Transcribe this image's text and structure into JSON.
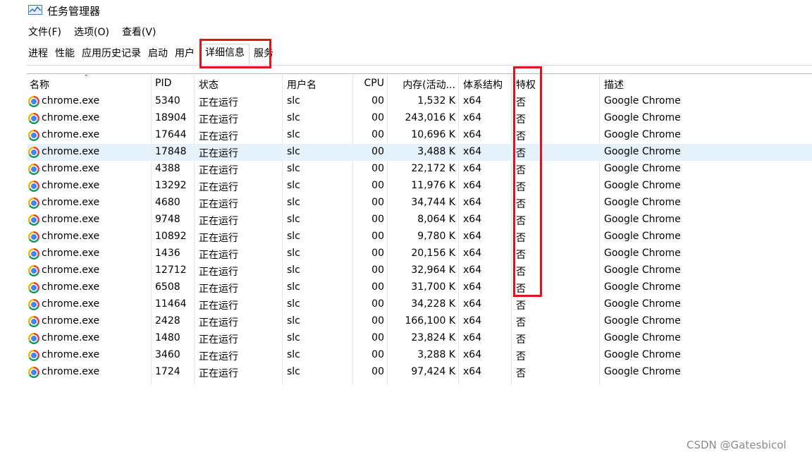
{
  "window": {
    "title": "任务管理器"
  },
  "menu": [
    "文件(F)",
    "选项(O)",
    "查看(V)"
  ],
  "tabs": [
    "进程",
    "性能",
    "应用历史记录",
    "启动",
    "用户",
    "详细信息",
    "服务"
  ],
  "active_tab": "详细信息",
  "columns": [
    "名称",
    "PID",
    "状态",
    "用户名",
    "CPU",
    "内存(活动...",
    "体系结构",
    "特权",
    "描述"
  ],
  "rows": [
    {
      "name": "chrome.exe",
      "pid": "5340",
      "status": "正在运行",
      "user": "slc",
      "cpu": "00",
      "mem": "1,532 K",
      "arch": "x64",
      "priv": "否",
      "desc": "Google Chrome"
    },
    {
      "name": "chrome.exe",
      "pid": "18904",
      "status": "正在运行",
      "user": "slc",
      "cpu": "00",
      "mem": "243,016 K",
      "arch": "x64",
      "priv": "否",
      "desc": "Google Chrome"
    },
    {
      "name": "chrome.exe",
      "pid": "17644",
      "status": "正在运行",
      "user": "slc",
      "cpu": "00",
      "mem": "10,696 K",
      "arch": "x64",
      "priv": "否",
      "desc": "Google Chrome"
    },
    {
      "name": "chrome.exe",
      "pid": "17848",
      "status": "正在运行",
      "user": "slc",
      "cpu": "00",
      "mem": "3,488 K",
      "arch": "x64",
      "priv": "否",
      "desc": "Google Chrome",
      "selected": true
    },
    {
      "name": "chrome.exe",
      "pid": "4388",
      "status": "正在运行",
      "user": "slc",
      "cpu": "00",
      "mem": "22,172 K",
      "arch": "x64",
      "priv": "否",
      "desc": "Google Chrome"
    },
    {
      "name": "chrome.exe",
      "pid": "13292",
      "status": "正在运行",
      "user": "slc",
      "cpu": "00",
      "mem": "11,976 K",
      "arch": "x64",
      "priv": "否",
      "desc": "Google Chrome"
    },
    {
      "name": "chrome.exe",
      "pid": "4680",
      "status": "正在运行",
      "user": "slc",
      "cpu": "00",
      "mem": "34,744 K",
      "arch": "x64",
      "priv": "否",
      "desc": "Google Chrome"
    },
    {
      "name": "chrome.exe",
      "pid": "9748",
      "status": "正在运行",
      "user": "slc",
      "cpu": "00",
      "mem": "8,064 K",
      "arch": "x64",
      "priv": "否",
      "desc": "Google Chrome"
    },
    {
      "name": "chrome.exe",
      "pid": "10892",
      "status": "正在运行",
      "user": "slc",
      "cpu": "00",
      "mem": "9,780 K",
      "arch": "x64",
      "priv": "否",
      "desc": "Google Chrome"
    },
    {
      "name": "chrome.exe",
      "pid": "1436",
      "status": "正在运行",
      "user": "slc",
      "cpu": "00",
      "mem": "20,156 K",
      "arch": "x64",
      "priv": "否",
      "desc": "Google Chrome"
    },
    {
      "name": "chrome.exe",
      "pid": "12712",
      "status": "正在运行",
      "user": "slc",
      "cpu": "00",
      "mem": "32,964 K",
      "arch": "x64",
      "priv": "否",
      "desc": "Google Chrome"
    },
    {
      "name": "chrome.exe",
      "pid": "6508",
      "status": "正在运行",
      "user": "slc",
      "cpu": "00",
      "mem": "31,700 K",
      "arch": "x64",
      "priv": "否",
      "desc": "Google Chrome"
    },
    {
      "name": "chrome.exe",
      "pid": "11464",
      "status": "正在运行",
      "user": "slc",
      "cpu": "00",
      "mem": "34,228 K",
      "arch": "x64",
      "priv": "否",
      "desc": "Google Chrome"
    },
    {
      "name": "chrome.exe",
      "pid": "2428",
      "status": "正在运行",
      "user": "slc",
      "cpu": "00",
      "mem": "166,100 K",
      "arch": "x64",
      "priv": "否",
      "desc": "Google Chrome"
    },
    {
      "name": "chrome.exe",
      "pid": "1480",
      "status": "正在运行",
      "user": "slc",
      "cpu": "00",
      "mem": "23,824 K",
      "arch": "x64",
      "priv": "否",
      "desc": "Google Chrome"
    },
    {
      "name": "chrome.exe",
      "pid": "3460",
      "status": "正在运行",
      "user": "slc",
      "cpu": "00",
      "mem": "3,288 K",
      "arch": "x64",
      "priv": "否",
      "desc": "Google Chrome"
    },
    {
      "name": "chrome.exe",
      "pid": "1724",
      "status": "正在运行",
      "user": "slc",
      "cpu": "00",
      "mem": "97,424 K",
      "arch": "x64",
      "priv": "否",
      "desc": "Google Chrome"
    }
  ],
  "watermark": "CSDN @Gatesbicol",
  "colors": {
    "annotation": "#e2141b",
    "selected_row": "#e5f1fb"
  },
  "icons": {
    "app": "task-manager-icon",
    "row": "chrome-icon",
    "sort": "sort-up-arrow"
  }
}
